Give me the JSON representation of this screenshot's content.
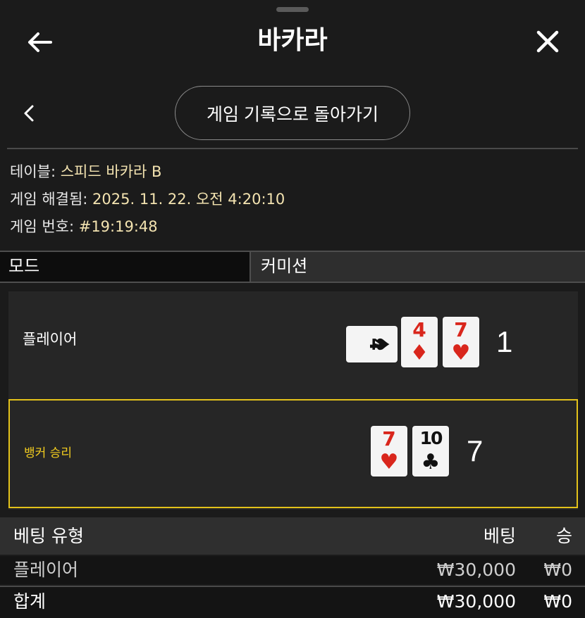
{
  "header": {
    "title": "바카라",
    "back_icon": "arrow-left-icon",
    "close_icon": "close-icon"
  },
  "subnav": {
    "chevron_icon": "chevron-left-icon",
    "back_to_history_label": "게임 기록으로 돌아가기"
  },
  "info": {
    "table_label": "테이블:",
    "table_value": "스피드 바카라 B",
    "resolved_label": "게임 해결됨:",
    "resolved_value": "2025. 11. 22. 오전 4:20:10",
    "game_no_label": "게임 번호:",
    "game_no_value": "#19:19:48"
  },
  "tabs": {
    "mode": "모드",
    "commission": "커미션"
  },
  "results": {
    "player": {
      "label": "플레이어",
      "score": "1",
      "cards": [
        {
          "rank": "4",
          "suit": "♠",
          "color": "black",
          "orientation": "horizontal"
        },
        {
          "rank": "4",
          "suit": "♦",
          "color": "red",
          "orientation": "vertical"
        },
        {
          "rank": "7",
          "suit": "♥",
          "color": "red",
          "orientation": "vertical"
        }
      ]
    },
    "banker": {
      "label": "뱅커 승리",
      "score": "7",
      "cards": [
        {
          "rank": "7",
          "suit": "♥",
          "color": "red",
          "orientation": "vertical"
        },
        {
          "rank": "10",
          "suit": "♣",
          "color": "black",
          "orientation": "vertical"
        }
      ]
    },
    "colors": {
      "winner_border": "#e3c21a",
      "red_suit": "#d9261c"
    }
  },
  "bets": {
    "header": {
      "type": "베팅 유형",
      "bet": "베팅",
      "win": "승"
    },
    "rows": [
      {
        "type": "플레이어",
        "bet": "₩30,000",
        "win": "₩0"
      }
    ],
    "total": {
      "type": "합계",
      "bet": "₩30,000",
      "win": "₩0"
    }
  }
}
